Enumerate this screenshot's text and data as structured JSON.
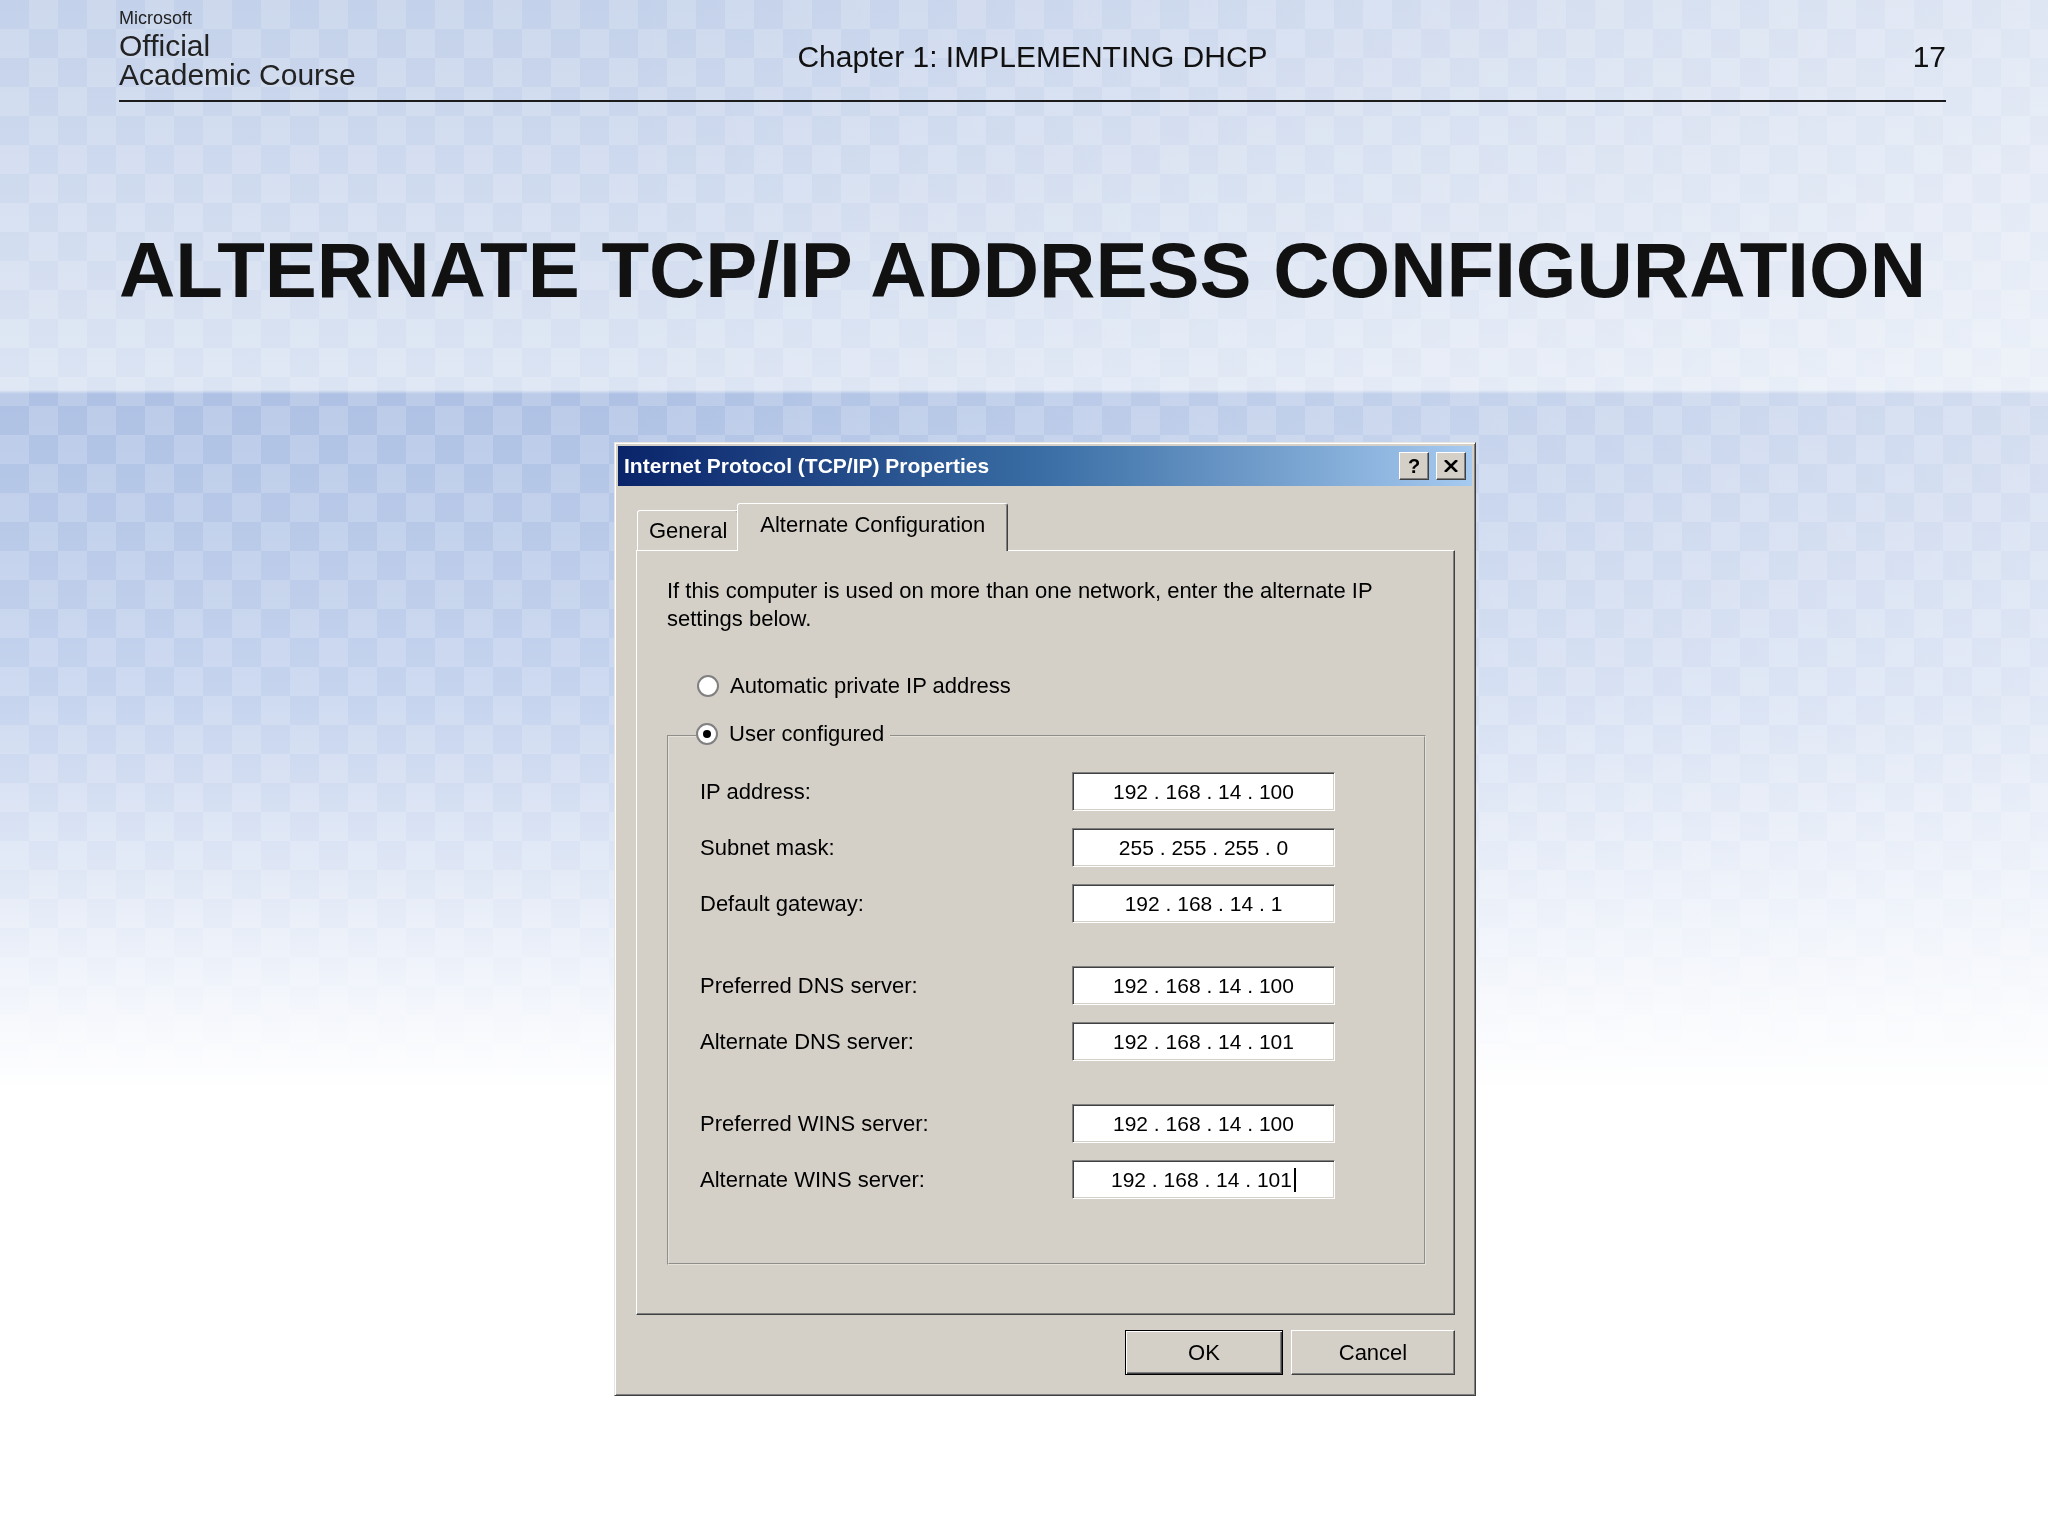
{
  "slide_header": {
    "logo": {
      "company": "Microsoft",
      "lines": [
        "Official",
        "Academic Course"
      ]
    },
    "chapter": "Chapter 1: IMPLEMENTING DHCP",
    "page_number": "17"
  },
  "title": "ALTERNATE TCP/IP ADDRESS CONFIGURATION",
  "dialog": {
    "title": "Internet Protocol (TCP/IP) Properties",
    "help_button": "?",
    "tabs": [
      {
        "label": "General",
        "selected": false
      },
      {
        "label": "Alternate Configuration",
        "selected": true
      }
    ],
    "intro": "If this computer is used on more than one network, enter the alternate IP settings below.",
    "options": [
      {
        "label": "Automatic private IP address",
        "selected": false
      },
      {
        "label": "User configured",
        "selected": true
      }
    ],
    "field_groups": [
      [
        {
          "label": "IP address:",
          "value": "192 . 168 . 14 . 100",
          "focused": false
        },
        {
          "label": "Subnet mask:",
          "value": "255 . 255 . 255 . 0",
          "focused": false
        },
        {
          "label": "Default gateway:",
          "value": "192 . 168 . 14 . 1",
          "focused": false
        }
      ],
      [
        {
          "label": "Preferred DNS server:",
          "value": "192 . 168 . 14 . 100",
          "focused": false
        },
        {
          "label": "Alternate DNS server:",
          "value": "192 . 168 . 14 . 101",
          "focused": false
        }
      ],
      [
        {
          "label": "Preferred WINS server:",
          "value": "192 . 168 . 14 . 100",
          "focused": false
        },
        {
          "label": "Alternate WINS server:",
          "value": "192 . 168 . 14 . 101",
          "focused": true
        }
      ]
    ],
    "buttons": [
      {
        "label": "OK",
        "default": true
      },
      {
        "label": "Cancel",
        "default": false
      }
    ]
  }
}
